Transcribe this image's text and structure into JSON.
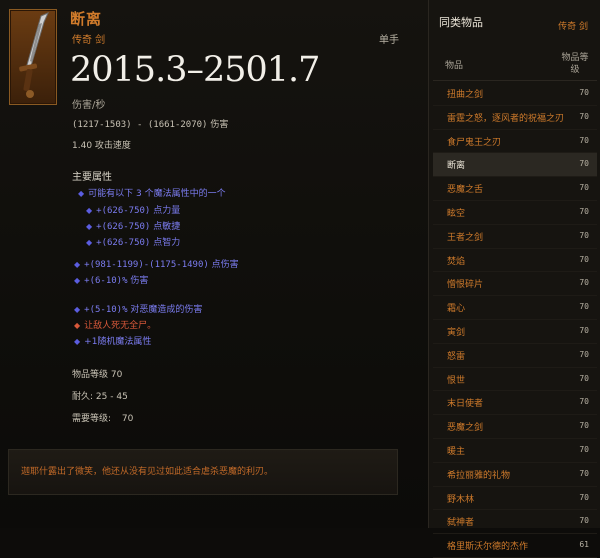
{
  "item": {
    "name": "断离",
    "type": "传奇 剑",
    "slot": "单手",
    "dps": "2015.3–2501.7",
    "dps_label": "伤害/秒",
    "damage_range": "(1217-1503) - (1661-2070)",
    "damage_label": "伤害",
    "attack_speed": "1.40",
    "attack_speed_label": "攻击速度",
    "primary_header": "主要属性",
    "random_header": "可能有以下 3 个魔法属性中的一个",
    "random_props": [
      {
        "value": "+(626-750)",
        "label": "点力量"
      },
      {
        "value": "+(626-750)",
        "label": "点敏捷"
      },
      {
        "value": "+(626-750)",
        "label": "点智力"
      }
    ],
    "props": [
      {
        "value": "+(981-1199)-(1175-1490)",
        "label": "点伤害"
      },
      {
        "value": "+(6-10)%",
        "label": "伤害"
      },
      {
        "value": "+(5-10)%",
        "label": "对恶魔造成的伤害"
      }
    ],
    "legendary_prop": "让敌人死无全尸。",
    "random_affix": "+1随机魔法属性",
    "item_level_label": "物品等级",
    "item_level": "70",
    "durability_label": "耐久:",
    "durability": "25 - 45",
    "required_level_label": "需要等级:",
    "required_level": "70",
    "flavor_text": "迦耶什露出了微笑，他还从没有见过如此适合虐杀恶魔的利刃。"
  },
  "sidebar": {
    "title": "同类物品",
    "class": "传奇 剑",
    "col_item": "物品",
    "col_level": "物品等级",
    "items": [
      {
        "name": "扭曲之剑",
        "level": "70"
      },
      {
        "name": "雷霆之怒，逐风者的祝福之刃",
        "level": "70"
      },
      {
        "name": "食尸鬼王之刃",
        "level": "70"
      },
      {
        "name": "断离",
        "level": "70"
      },
      {
        "name": "恶魔之舌",
        "level": "70"
      },
      {
        "name": "眩空",
        "level": "70"
      },
      {
        "name": "王者之剑",
        "level": "70"
      },
      {
        "name": "焚焰",
        "level": "70"
      },
      {
        "name": "憎恨碎片",
        "level": "70"
      },
      {
        "name": "霜心",
        "level": "70"
      },
      {
        "name": "寅剑",
        "level": "70"
      },
      {
        "name": "怒雷",
        "level": "70"
      },
      {
        "name": "恨世",
        "level": "70"
      },
      {
        "name": "末日使者",
        "level": "70"
      },
      {
        "name": "恶魔之剑",
        "level": "70"
      },
      {
        "name": "暖主",
        "level": "70"
      },
      {
        "name": "希拉丽雅的礼物",
        "level": "70"
      },
      {
        "name": "野木林",
        "level": "70"
      },
      {
        "name": "弑神者",
        "level": "70"
      },
      {
        "name": "格里斯沃尔德的杰作",
        "level": "61"
      }
    ],
    "selected_index": 3
  }
}
